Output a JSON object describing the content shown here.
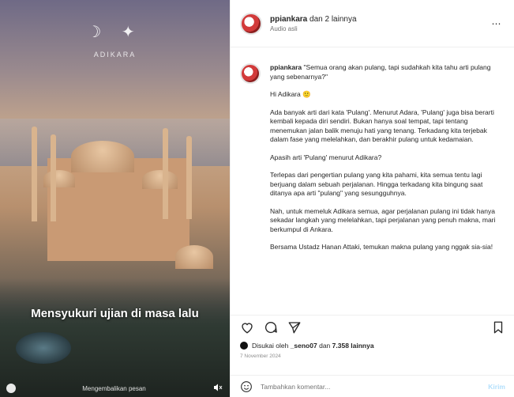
{
  "media": {
    "logo_text": "☽ ✦",
    "logo_sub": "ADIKARA",
    "caption": "Mensyukuri ujian di masa lalu",
    "audio_text": "Mengembalikan pesan"
  },
  "header": {
    "username": "ppiankara",
    "and_others": "dan 2 lainnya",
    "audio_line": "Audio asli",
    "more_icon": "⋯"
  },
  "caption_post": {
    "username": "ppiankara",
    "first_line": "\"Semua orang akan pulang, tapi sudahkah kita tahu arti pulang yang sebenarnya?\"",
    "greeting": "Hi Adikara 🙂",
    "p1": "Ada banyak arti dari kata 'Pulang'. Menurut Adara, 'Pulang' juga bisa berarti kembali kepada diri sendiri. Bukan hanya soal tempat, tapi tentang menemukan jalan balik menuju hati yang tenang. Terkadang kita terjebak dalam fase yang melelahkan, dan berakhir pulang untuk kedamaian.",
    "p2": "Apasih arti 'Pulang' menurut Adikara?",
    "p3": "Terlepas dari pengertian pulang yang kita pahami, kita semua tentu lagi berjuang dalam sebuah perjalanan. Hingga terkadang kita bingung saat ditanya apa arti \"pulang\" yang sesungguhnya.",
    "p4": "Nah, untuk memeluk Adikara semua, agar perjalanan pulang ini tidak hanya sekadar langkah yang melelahkan, tapi perjalanan yang penuh makna, mari berkumpul di Ankara.",
    "p5": "Bersama Ustadz Hanan Attaki, temukan makna pulang yang nggak sia-sia!"
  },
  "likes": {
    "prefix": "Disukai oleh",
    "liker": "_seno07",
    "middle": "dan",
    "count": "7.358 lainnya"
  },
  "date": "7 November 2024",
  "add_comment": {
    "placeholder": "Tambahkan komentar...",
    "post_label": "Kirim"
  },
  "icons": {
    "like": "heart-icon",
    "comment": "comment-icon",
    "share": "send-icon",
    "save": "bookmark-icon",
    "emoji": "emoji-icon"
  }
}
